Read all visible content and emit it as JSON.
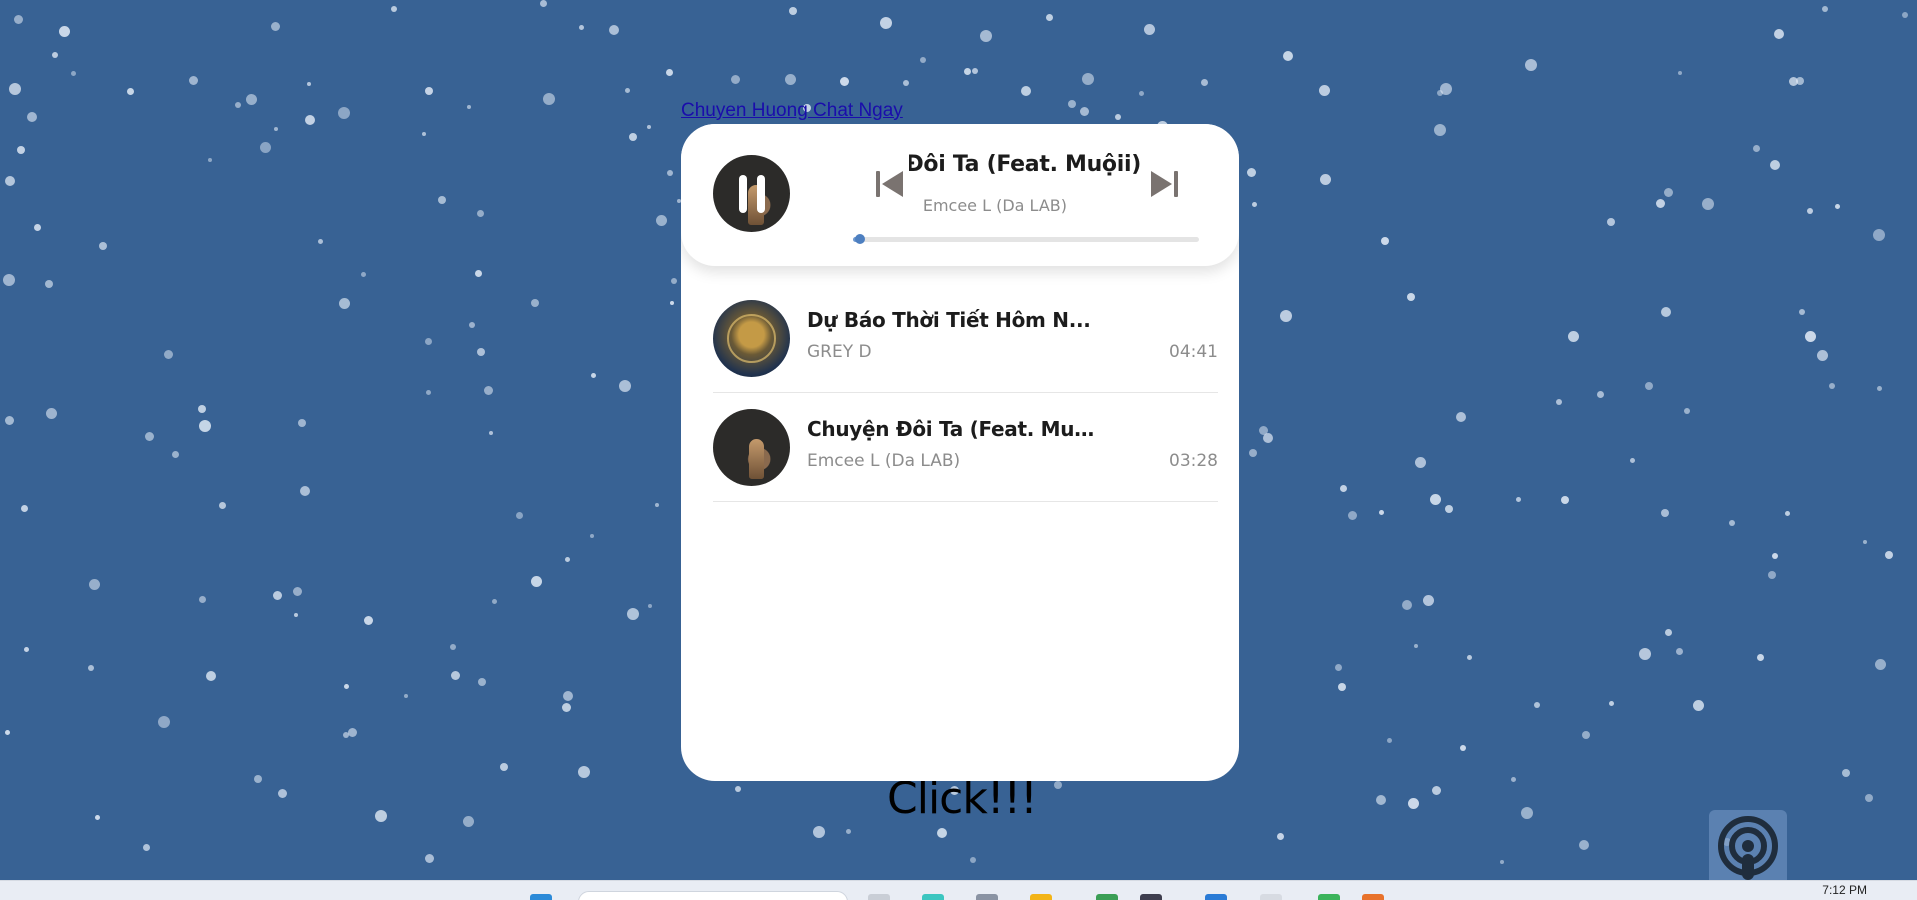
{
  "redirect_link": {
    "label": "Chuyen Huong Chat Ngay"
  },
  "now_playing": {
    "title": "Chuyện Đôi Ta (Feat. Muộii)",
    "artist": "Emcee L (Da LAB)",
    "progress_fraction": 0.02,
    "state": "playing",
    "accent_color": "#4d7fc0"
  },
  "playlist": {
    "tracks": [
      {
        "title": "Dự Báo Thời Tiết Hôm N...",
        "artist": "GREY D",
        "duration": "04:41"
      },
      {
        "title": "Chuyện Đôi Ta (Feat. Muộii)",
        "artist": "Emcee L (Da LAB)",
        "duration": "03:28"
      }
    ]
  },
  "click_text": "Click!!!",
  "taskbar": {
    "clock": "7:12 PM"
  },
  "colors": {
    "background": "#386294",
    "card": "#ffffff",
    "secondary_text": "#8c8c8c",
    "link": "#1a0dab"
  },
  "icons": {
    "pause": "pause-icon",
    "previous": "previous-track-icon",
    "next": "next-track-icon",
    "podcast": "podcast-icon"
  }
}
